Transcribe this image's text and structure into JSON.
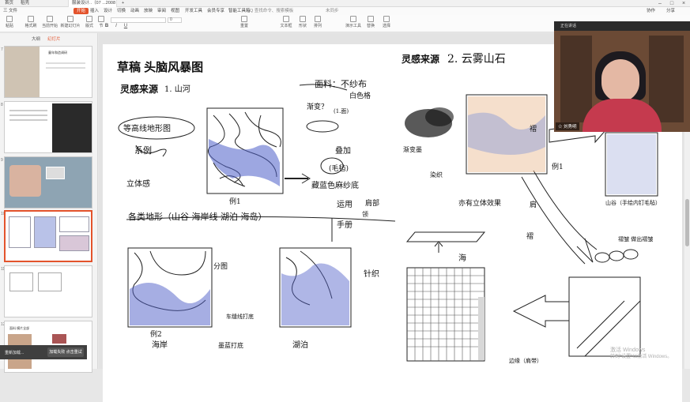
{
  "titlebar": {
    "tabs": [
      {
        "label": "首页"
      },
      {
        "label": "稻壳"
      },
      {
        "label": "服装设计..（07 ...2008 pptx）"
      }
    ],
    "new_tab": "+"
  },
  "menubar": {
    "file": "三 文件",
    "items": [
      "开始",
      "插入",
      "设计",
      "切换",
      "动画",
      "放映",
      "审阅",
      "视图",
      "开发工具",
      "会员专享",
      "智能工具箱"
    ],
    "search": "Q 查找命令、搜索模板",
    "sync": "未同步",
    "collab": "协作",
    "share": "分享"
  },
  "ribbon": {
    "buttons": [
      "粘贴",
      "格式刷",
      "当前开始",
      "新建幻灯片",
      "版式",
      "节",
      "重置",
      "文本框",
      "形状",
      "排列",
      "演示工具",
      "替换",
      "选择"
    ],
    "font": "",
    "size": "0"
  },
  "thumbpanel": {
    "tabs": [
      "大纲",
      "幻灯片"
    ],
    "slide_numbers": [
      "7",
      "8",
      "9",
      "10",
      "11",
      "12"
    ],
    "thumb_titles": [
      "童年和造调研",
      "",
      "",
      "",
      "",
      "面料 模片全部"
    ]
  },
  "slide": {
    "title": "草稿  头脑风暴图",
    "subtitle_left": "灵感来源",
    "subtitle_left_hand": "1. 山河",
    "subtitle_right": "灵感来源",
    "subtitle_right_hand": "2. 云雾山石",
    "notes": [
      "等高线地形图",
      "系例",
      "立体感",
      "例1",
      "藏蓝色麻纱底",
      "面料：不纱布",
      "白色格",
      "渐变？",
      "(1.面)",
      "叠加",
      "(毛毡)",
      "各类地形（山谷 海岸线 湖泊 海岛）",
      "运用",
      "手册",
      "肩部",
      "海岸",
      "例2",
      "湖泊",
      "墨蓝打底",
      "针织",
      "车缝线打底",
      "渐变墨",
      "染织",
      "亦有立体效果",
      "褶",
      "例1",
      "山谷（手绘内钉毛毡）",
      "肩",
      "褶",
      "褶皱 做出褶皱",
      "海",
      "边缘（肩带）",
      "领",
      "分图"
    ]
  },
  "video": {
    "top_label": "正在讲话",
    "name": "☆ 刘秀明"
  },
  "notification": {
    "text": "重新加载...",
    "button": "加载失败 点击重试"
  },
  "watermark": {
    "line1": "激活 Windows",
    "line2": "转到\"设置\"以激活 Windows。"
  },
  "colors": {
    "accent": "#e3532c",
    "sketch_blue": "#4d5ec8"
  }
}
